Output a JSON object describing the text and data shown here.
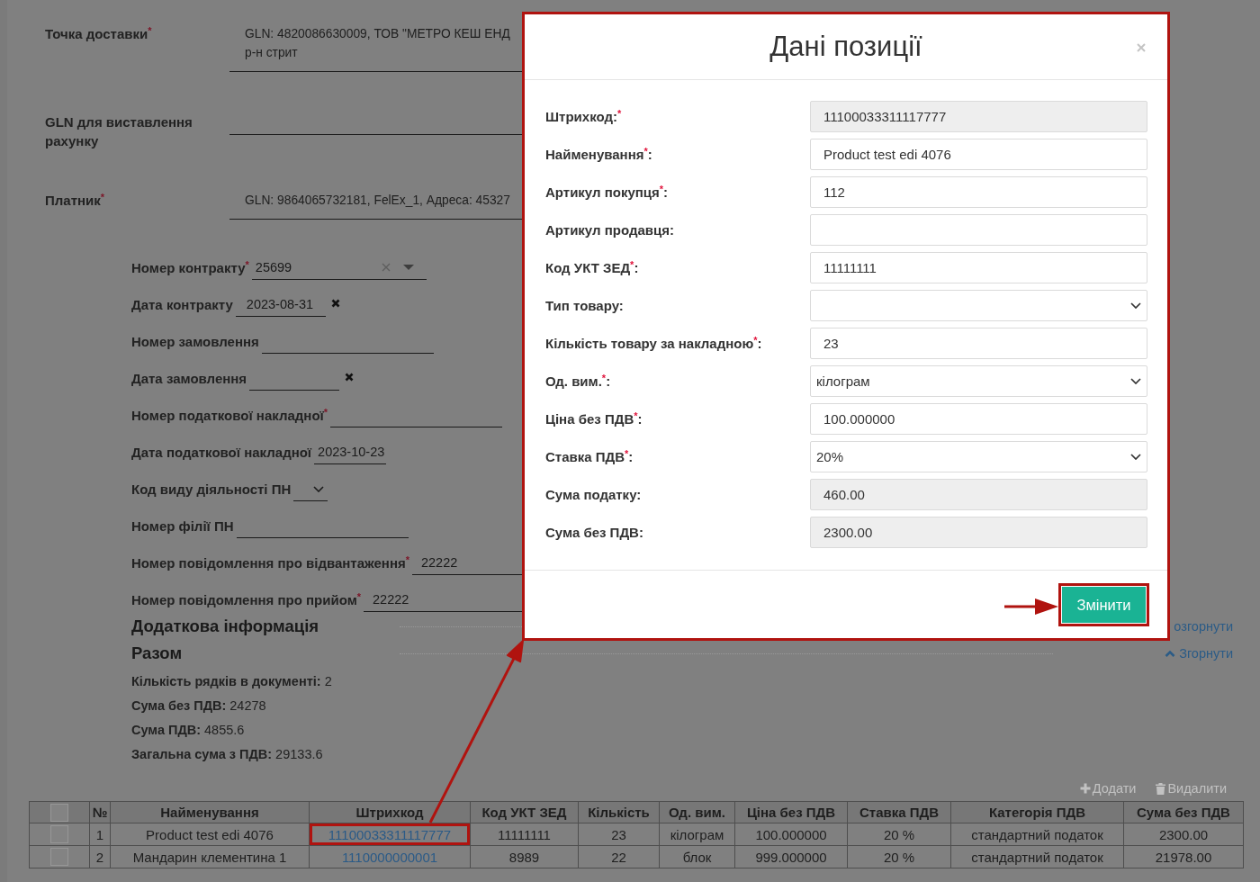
{
  "delivery_form": {
    "fields": [
      {
        "label": "Точка доставки$^{*}$",
        "value_lines": [
          "GLN: 4820086630009, ТОВ \"МЕТРО КЕШ ЕНД",
          "р-н стрит"
        ]
      },
      {
        "label": "GLN для виставлення рахунку"
      },
      {
        "label": "Платник$^{*}$",
        "value_lines": [
          "GLN: 9864065732181, FelEx_1, Адреса: 45327"
        ]
      }
    ]
  },
  "contract_form": {
    "fields": [
      {
        "kind": "combo",
        "label": "Номер контракту$^{*}$",
        "value": "25699"
      },
      {
        "kind": "date",
        "label": "Дата контракту",
        "value": "2023-08-31",
        "clearable": true
      },
      {
        "kind": "text",
        "label": "Номер замовлення"
      },
      {
        "kind": "date",
        "label": "Дата замовлення",
        "clearable": true
      },
      {
        "kind": "text",
        "label": "Номер податкової накладної$^{*}$"
      },
      {
        "kind": "date",
        "label": "Дата податкової накладної",
        "value": "2023-10-23",
        "clearable": false
      },
      {
        "kind": "select",
        "label": "Код виду діяльності ПН"
      },
      {
        "kind": "text",
        "label": "Номер філії ПН"
      },
      {
        "kind": "text",
        "label": "Номер повідомлення про відвантаження$^{*}$",
        "value": "22222"
      },
      {
        "kind": "text",
        "label": "Номер повідомлення про прийом$^{*}$",
        "value": "22222"
      }
    ]
  },
  "sections": [
    {
      "title": "Додаткова інформація",
      "link": {
        "kind": "expand",
        "label": "озгорнути"
      }
    },
    {
      "title": "Разом",
      "link": {
        "kind": "collapse",
        "label": "Згорнути"
      }
    }
  ],
  "totals": [
    "**Кількість рядків в документі:** 2",
    "**Сума без ПДВ:** 24278",
    "**Сума ПДВ:** 4855.6",
    "**Загальна сума з ПДВ:** 29133.6"
  ],
  "table": {
    "toolbar": [
      {
        "kind": "add",
        "label": "Додати"
      },
      {
        "kind": "delete",
        "label": "Видалити"
      }
    ],
    "select_all_checked": false,
    "columns": [
      {
        "kind": "text",
        "label": "№"
      },
      {
        "kind": "text",
        "label": "Найменування"
      },
      {
        "kind": "link",
        "label": "Штрихкод"
      },
      {
        "kind": "text",
        "label": "Код УКТ ЗЕД"
      },
      {
        "kind": "text",
        "label": "Кількість"
      },
      {
        "kind": "text",
        "label": "Од. вим."
      },
      {
        "kind": "text",
        "label": "Ціна без ПДВ"
      },
      {
        "kind": "text",
        "label": "Ставка ПДВ"
      },
      {
        "kind": "text",
        "label": "Категорія ПДВ"
      },
      {
        "kind": "text",
        "label": "Сума без ПДВ"
      }
    ],
    "rows": [
      {
        "checked": false,
        "barcode_highlighted": true,
        "cells": [
          "1",
          "Product test edi 4076",
          "11100033311117777",
          "11111111",
          "23",
          "кілограм",
          "100.000000",
          "20 %",
          "стандартний податок",
          "2300.00"
        ]
      },
      {
        "checked": false,
        "barcode_highlighted": false,
        "cells": [
          "2",
          "Мандарин клементина 1",
          "1110000000001",
          "8989",
          "22",
          "блок",
          "999.000000",
          "20 %",
          "стандартний податок",
          "21978.00"
        ]
      }
    ]
  },
  "modal": {
    "title": "Дані позиції",
    "highlighted": true,
    "fields": [
      {
        "kind": "input",
        "label": "Штрихкод:$^{*}$",
        "value": "11100033311117777",
        "readonly": true
      },
      {
        "kind": "input",
        "label": "Найменування$^{*}$:",
        "value": "Product test edi 4076",
        "readonly": false
      },
      {
        "kind": "input",
        "label": "Артикул покупця$^{*}$:",
        "value": "112",
        "readonly": false
      },
      {
        "kind": "input",
        "label": "Артикул продавця:",
        "readonly": false
      },
      {
        "kind": "input",
        "label": "Код УКТ ЗЕД$^{*}$:",
        "value": "11111111",
        "readonly": false
      },
      {
        "kind": "select",
        "label": "Тип товару:"
      },
      {
        "kind": "input",
        "label": "Кількість товару за накладною$^{*}$:",
        "value": "23",
        "readonly": false
      },
      {
        "kind": "select",
        "label": "Од. вим.$^{*}$:",
        "value": "кілограм"
      },
      {
        "kind": "input",
        "label": "Ціна без ПДВ$^{*}$:",
        "value": "100.000000",
        "readonly": false
      },
      {
        "kind": "select",
        "label": "Ставка ПДВ$^{*}$:",
        "value": "20%"
      },
      {
        "kind": "input",
        "label": "Сума податку:",
        "value": "460.00",
        "readonly": true
      },
      {
        "kind": "input",
        "label": "Сума без ПДВ:",
        "value": "2300.00",
        "readonly": true
      }
    ],
    "submit": {
      "label": "Змінити",
      "highlighted": true
    }
  }
}
